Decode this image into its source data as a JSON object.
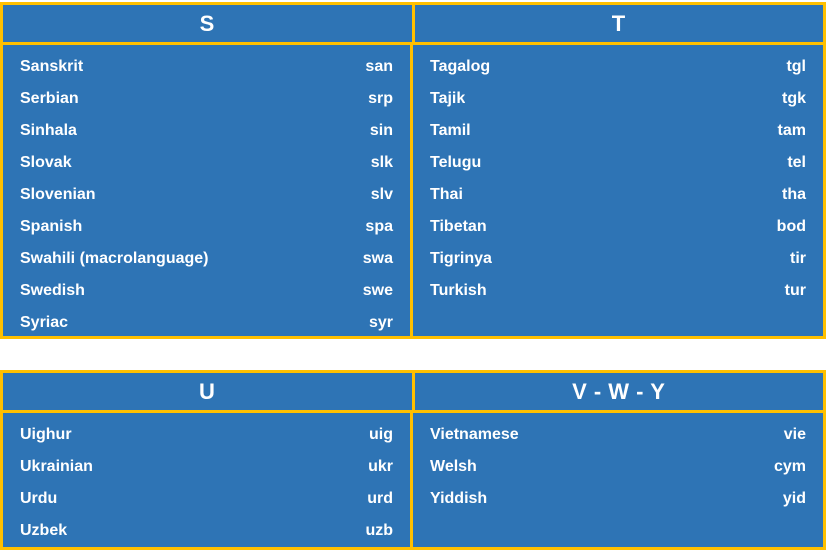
{
  "colors": {
    "panel_background": "#2E74B5",
    "border": "#FFC000",
    "text": "#FFFFFF",
    "page_background": "#FFFFFF"
  },
  "tables": [
    {
      "id": "table-top",
      "columns": [
        {
          "header": "S",
          "rows": [
            {
              "name": "Sanskrit",
              "code": "san"
            },
            {
              "name": "Serbian",
              "code": "srp"
            },
            {
              "name": "Sinhala",
              "code": "sin"
            },
            {
              "name": "Slovak",
              "code": "slk"
            },
            {
              "name": "Slovenian",
              "code": "slv"
            },
            {
              "name": "Spanish",
              "code": "spa"
            },
            {
              "name": "Swahili (macrolanguage)",
              "code": "swa"
            },
            {
              "name": "Swedish",
              "code": "swe"
            },
            {
              "name": "Syriac",
              "code": "syr"
            }
          ]
        },
        {
          "header": "T",
          "rows": [
            {
              "name": "Tagalog",
              "code": "tgl"
            },
            {
              "name": "Tajik",
              "code": "tgk"
            },
            {
              "name": "Tamil",
              "code": "tam"
            },
            {
              "name": "Telugu",
              "code": "tel"
            },
            {
              "name": "Thai",
              "code": "tha"
            },
            {
              "name": "Tibetan",
              "code": "bod"
            },
            {
              "name": "Tigrinya",
              "code": "tir"
            },
            {
              "name": "Turkish",
              "code": "tur"
            }
          ]
        }
      ]
    },
    {
      "id": "table-bottom",
      "columns": [
        {
          "header": "U",
          "rows": [
            {
              "name": "Uighur",
              "code": "uig"
            },
            {
              "name": "Ukrainian",
              "code": "ukr"
            },
            {
              "name": "Urdu",
              "code": "urd"
            },
            {
              "name": "Uzbek",
              "code": "uzb"
            }
          ]
        },
        {
          "header": "V - W - Y",
          "rows": [
            {
              "name": "Vietnamese",
              "code": "vie"
            },
            {
              "name": "Welsh",
              "code": "cym"
            },
            {
              "name": "Yiddish",
              "code": "yid"
            }
          ]
        }
      ]
    }
  ]
}
